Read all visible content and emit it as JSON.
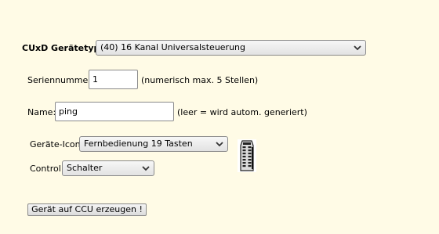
{
  "device_type": {
    "label": "CUxD Gerätetyp:",
    "selected": "(40) 16 Kanal Universalsteuerung"
  },
  "serial": {
    "label": "Seriennummer:",
    "value": "1",
    "hint": "(numerisch max. 5 Stellen)"
  },
  "name": {
    "label": "Name:",
    "value": "ping",
    "hint": "(leer = wird autom. generiert)"
  },
  "device_icon": {
    "label": "Geräte-Icon:",
    "selected": "Fernbedienung 19 Tasten",
    "icon": "remote-control-icon"
  },
  "control": {
    "label": "Control:",
    "selected": "Schalter"
  },
  "create_button": {
    "label": "Gerät auf CCU erzeugen !"
  }
}
